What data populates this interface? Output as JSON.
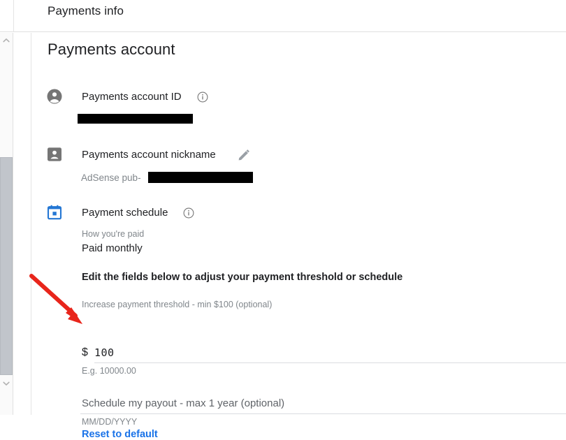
{
  "header": {
    "title": "Payments info"
  },
  "scrollbar": {
    "up_arrow": "chevron-up-icon",
    "down_arrow": "chevron-down-icon"
  },
  "page": {
    "title": "Payments account"
  },
  "sections": {
    "account_id": {
      "icon": "account-circle-icon",
      "label": "Payments account ID",
      "info_icon": "info-icon",
      "value": "",
      "redacted": true
    },
    "nickname": {
      "icon": "contact-badge-icon",
      "label": "Payments account nickname",
      "edit_icon": "pencil-icon",
      "value_prefix": "AdSense pub-",
      "redacted": true
    },
    "payment_schedule": {
      "icon": "calendar-icon",
      "label": "Payment schedule",
      "info_icon": "info-icon",
      "how_paid_label": "How you're paid",
      "how_paid_value": "Paid monthly",
      "edit_instructions": "Edit the fields below to adjust your payment threshold or schedule",
      "threshold": {
        "label": "Increase payment threshold - min $100 (optional)",
        "currency": "$",
        "value": "100",
        "hint": "E.g. 10000.00"
      },
      "payout_date": {
        "label": "Schedule my payout - max 1 year (optional)",
        "value": "",
        "format_hint": "MM/DD/YYYY"
      },
      "reset_link": "Reset to default"
    }
  },
  "colors": {
    "accent_blue": "#1a73e8",
    "calendar_blue": "#2477d4",
    "icon_gray": "#757575",
    "text_primary": "#202124",
    "text_muted": "#80868b",
    "annotation_red": "#e8251b"
  }
}
